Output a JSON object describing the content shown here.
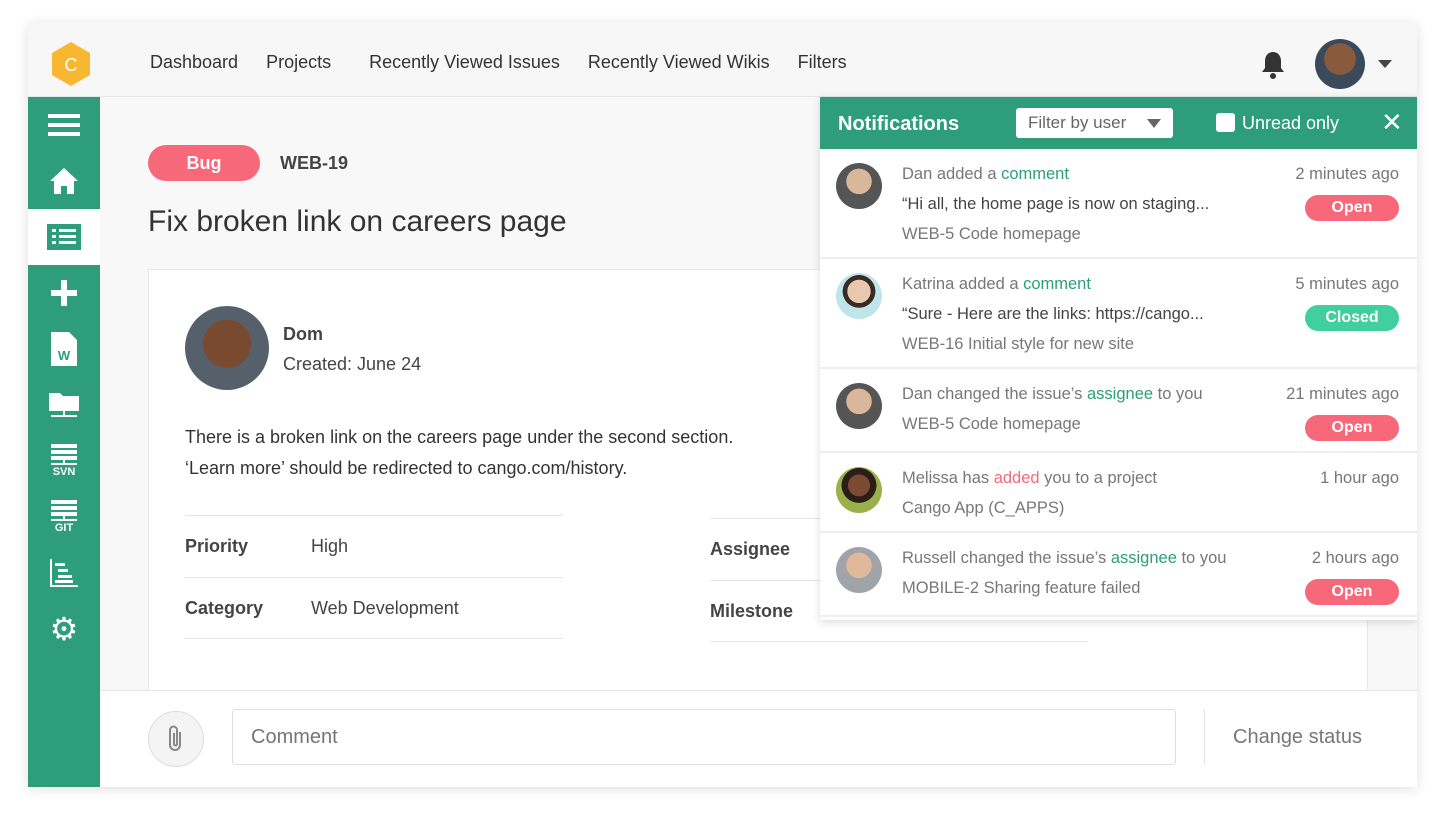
{
  "nav": {
    "items": [
      "Dashboard",
      "Projects",
      "Recently Viewed Issues",
      "Recently Viewed Wikis",
      "Filters"
    ],
    "logo_letter": "C"
  },
  "sidebar": {
    "items": [
      "menu-icon",
      "home-icon",
      "issues-list-icon",
      "add-icon",
      "wiki-document-icon",
      "folder-network-icon",
      "svn-icon",
      "git-icon",
      "gantt-chart-icon",
      "settings-icon"
    ],
    "svn": "SVN",
    "git": "GIT",
    "wiki_letter": "W"
  },
  "issue": {
    "type": "Bug",
    "key": "WEB-19",
    "title": "Fix broken link on careers page",
    "author": "Dom",
    "created": "Created: June 24",
    "description_1": "There is a broken link on the careers page under the second section.",
    "description_2": "‘Learn more’ should be redirected to cango.com/history.",
    "fields": [
      {
        "label": "Priority",
        "value": "High"
      },
      {
        "label": "Category",
        "value": "Web Development"
      },
      {
        "label": "Assignee",
        "value": ""
      },
      {
        "label": "Milestone",
        "value": ""
      }
    ]
  },
  "bottom": {
    "comment_placeholder": "Comment",
    "change_status": "Change status"
  },
  "notifications": {
    "title": "Notifications",
    "filter": "Filter by user",
    "unread_only": "Unread only",
    "unread_checked": false,
    "items": [
      {
        "pre": "Dan added a ",
        "link": "comment",
        "link_color": "green",
        "post": "",
        "time": "2 minutes ago",
        "quote": "“Hi all, the home page is now on staging...",
        "issue": "WEB-5 Code homepage",
        "status": "Open"
      },
      {
        "pre": "Katrina added a ",
        "link": "comment",
        "link_color": "green",
        "post": "",
        "time": "5 minutes ago",
        "quote": "“Sure - Here are the links: https://cango...",
        "issue": "WEB-16 Initial style for new site",
        "status": "Closed"
      },
      {
        "pre": "Dan changed the issue’s ",
        "link": "assignee",
        "link_color": "green",
        "post": " to you",
        "time": "21 minutes ago",
        "quote": "",
        "issue": "WEB-5 Code homepage",
        "status": "Open"
      },
      {
        "pre": "Melissa has ",
        "link": "added",
        "link_color": "red",
        "post": " you to a project",
        "time": "1 hour ago",
        "quote": "",
        "issue": "Cango App (C_APPS)",
        "status": ""
      },
      {
        "pre": "Russell changed the issue’s ",
        "link": "assignee",
        "link_color": "green",
        "post": " to you",
        "time": "2 hours ago",
        "quote": "",
        "issue": "MOBILE-2 Sharing feature failed",
        "status": "Open"
      }
    ]
  },
  "colors": {
    "brand": "#2e9e7a",
    "open": "#f7697a",
    "closed": "#42cfa0",
    "logo": "#f7b731"
  }
}
